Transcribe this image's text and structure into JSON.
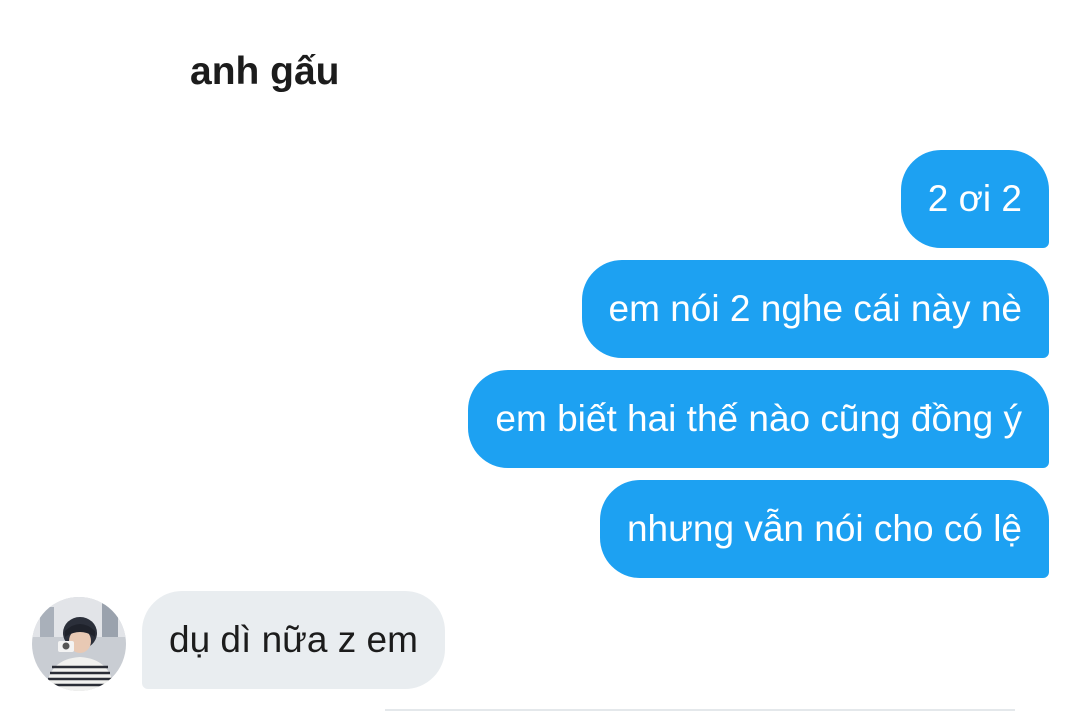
{
  "header": {
    "contact_name": "anh gấu"
  },
  "messages": [
    {
      "direction": "sent",
      "text": "2 ơi 2"
    },
    {
      "direction": "sent",
      "text": "em nói 2 nghe cái này nè"
    },
    {
      "direction": "sent",
      "text": "em biết hai thế nào cũng đồng ý"
    },
    {
      "direction": "sent",
      "text": "nhưng vẫn nói cho có lệ"
    },
    {
      "direction": "received",
      "text": "dụ dì nữa z em"
    }
  ],
  "colors": {
    "sent_bubble": "#1da1f2",
    "received_bubble": "#e9edf0"
  },
  "icons": {
    "avatar": "contact-avatar-photo"
  }
}
